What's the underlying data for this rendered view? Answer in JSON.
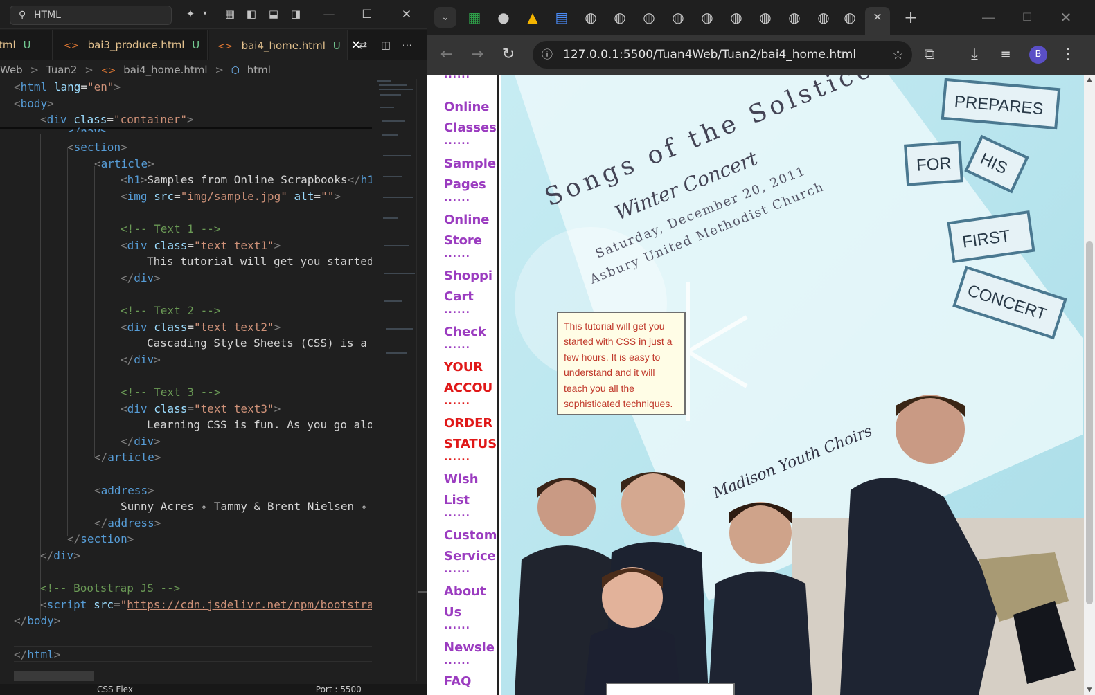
{
  "vscode": {
    "search_text": "HTML",
    "tabs": [
      {
        "name": "tml",
        "flag": "U"
      },
      {
        "name": "bai3_produce.html",
        "flag": "U"
      },
      {
        "name": "bai4_home.html",
        "flag": "U"
      }
    ],
    "breadcrumb": [
      "Web",
      "Tuan2",
      "bai4_home.html",
      "html"
    ],
    "code": {
      "l1_tag": "html",
      "l1_attr": "lang",
      "l1_val": "\"en\"",
      "l2_tag": "body",
      "l3_tag": "div",
      "l3_attr": "class",
      "l3_val": "\"container\"",
      "l4": "</nav>",
      "l5_tag": "section",
      "l6_tag": "article",
      "l7_text": "Samples from Online Scrapbooks",
      "l8_attr1": "src",
      "l8_val1": "img/sample.jpg",
      "l8_attr2": "alt",
      "l8_val2": "\"\"",
      "c1": "<!-- Text 1 -->",
      "d1_val": "\"text text1\"",
      "t1": "This tutorial will get you started",
      "c2": "<!-- Text 2 -->",
      "d2_val": "\"text text2\"",
      "t2": "Cascading Style Sheets (CSS) is a",
      "c3": "<!-- Text 3 -->",
      "d3_val": "\"text text3\"",
      "t3": "Learning CSS is fun. As you go alo",
      "addr_text": "Sunny Acres ✧ Tammy & Brent Nielsen ✧",
      "c4": "<!-- Bootstrap JS -->",
      "script_src": "https://cdn.jsdelivr.net/npm/bootstra"
    },
    "status": [
      "CSS Flex",
      "Port : 5500"
    ]
  },
  "chrome": {
    "url": "127.0.0.1:5500/Tuan4Web/Tuan2/bai4_home.html",
    "profile_initial": "B",
    "nav_items": [
      {
        "label1": "Online",
        "label2": "Classes",
        "color": "purple"
      },
      {
        "label1": "Sample",
        "label2": "Pages",
        "color": "purple"
      },
      {
        "label1": "Online",
        "label2": "Store",
        "color": "purple"
      },
      {
        "label1": "Shoppi",
        "label2": "Cart",
        "color": "purple"
      },
      {
        "label1": "Check",
        "label2": "",
        "color": "purple"
      },
      {
        "label1": "YOUR",
        "label2": "ACCOU",
        "color": "red"
      },
      {
        "label1": "ORDER",
        "label2": "STATUS",
        "color": "red"
      },
      {
        "label1": "Wish",
        "label2": "List",
        "color": "purple"
      },
      {
        "label1": "Custom",
        "label2": "Service",
        "color": "purple"
      },
      {
        "label1": "About",
        "label2": "Us",
        "color": "purple"
      },
      {
        "label1": "Newsle",
        "label2": "",
        "color": "purple"
      },
      {
        "label1": "FAQ",
        "label2": "",
        "color": "purple"
      }
    ],
    "dots": "......",
    "photo": {
      "title": "Songs of the Solstice",
      "subtitle": "Winter Concert",
      "date": "Saturday, December 20, 2011",
      "venue": "Asbury United Methodist Church",
      "choir": "Madison Youth Choirs",
      "tiles": [
        "PREPARES",
        "FOR",
        "HIS",
        "FIRST",
        "CONCERT"
      ]
    },
    "tooltip": "This tutorial will get you started with CSS in just a few hours. It is easy to understand and it will teach you all the sophisticated techniques."
  }
}
